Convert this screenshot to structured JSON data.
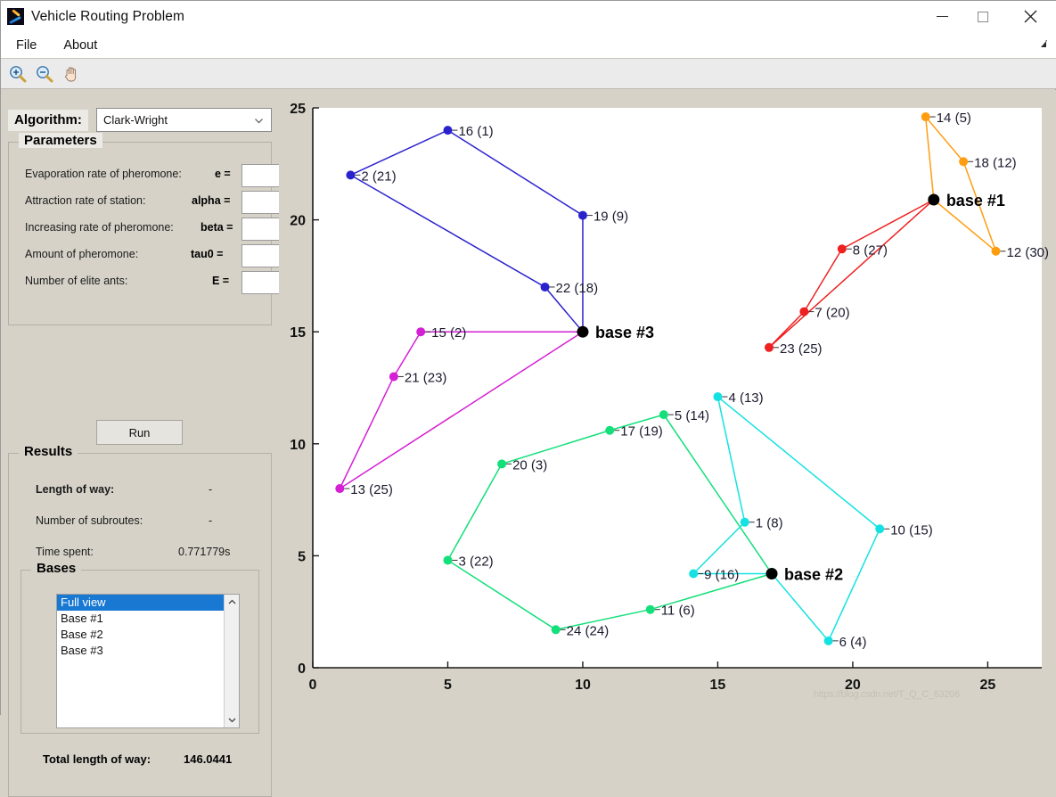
{
  "window": {
    "title": "Vehicle Routing Problem",
    "icon": "matlab-icon",
    "controls": {
      "minimize": "—",
      "maximize": "▢",
      "close": "✕"
    }
  },
  "menubar": {
    "items": [
      "File",
      "About"
    ],
    "right_icon": "undock-icon"
  },
  "toolbar": {
    "buttons": [
      "zoom-in-icon",
      "zoom-out-icon",
      "pan-hand-icon"
    ]
  },
  "algorithm": {
    "label": "Algorithm:",
    "selected": "Clark-Wright",
    "options": [
      "Clark-Wright"
    ]
  },
  "parameters": {
    "title": "Parameters",
    "rows": [
      {
        "label": "Evaporation rate of pheromone:",
        "symbol": "e =",
        "value": ""
      },
      {
        "label": "Attraction rate of station:",
        "symbol": "alpha =",
        "value": ""
      },
      {
        "label": "Increasing rate of pheromone:",
        "symbol": "beta =",
        "value": ""
      },
      {
        "label": "Amount of pheromone:",
        "symbol": "tau0 =",
        "value": ""
      },
      {
        "label": "Number of elite ants:",
        "symbol": "E =",
        "value": ""
      }
    ]
  },
  "run_button": {
    "label": "Run"
  },
  "results": {
    "title": "Results",
    "length_of_way_label": "Length of way:",
    "length_of_way_value": "-",
    "number_of_subroutes_label": "Number of subroutes:",
    "number_of_subroutes_value": "-",
    "time_spent_label": "Time spent:",
    "time_spent_value": "0.771779s",
    "bases": {
      "title": "Bases",
      "items": [
        "Full view",
        "Base #1",
        "Base #2",
        "Base #3"
      ],
      "selected_index": 0
    },
    "total_length_label": "Total length of way:",
    "total_length_value": "146.0441"
  },
  "watermark": "https://blog.csdn.net/T_Q_C_63206",
  "chart_data": {
    "type": "scatter",
    "title": "",
    "xlabel": "",
    "ylabel": "",
    "xlim": [
      0,
      27
    ],
    "ylim": [
      0,
      25
    ],
    "xticks": [
      0,
      5,
      10,
      15,
      20,
      25
    ],
    "yticks": [
      0,
      5,
      10,
      15,
      20,
      25
    ],
    "grid": false,
    "legend": "none",
    "bases": [
      {
        "name": "base #1",
        "x": 23.0,
        "y": 20.9,
        "color": "#000000"
      },
      {
        "name": "base #2",
        "x": 17.0,
        "y": 4.2,
        "color": "#000000"
      },
      {
        "name": "base #3",
        "x": 10.0,
        "y": 15.0,
        "color": "#000000"
      }
    ],
    "nodes": [
      {
        "id": 16,
        "demand": 1,
        "label": "16 (1)",
        "x": 5.0,
        "y": 24.0,
        "color": "#2a22cc"
      },
      {
        "id": 2,
        "demand": 21,
        "label": "2 (21)",
        "x": 1.4,
        "y": 22.0,
        "color": "#2a22cc"
      },
      {
        "id": 19,
        "demand": 9,
        "label": "19 (9)",
        "x": 10.0,
        "y": 20.2,
        "color": "#2a22cc"
      },
      {
        "id": 22,
        "demand": 18,
        "label": "22 (18)",
        "x": 8.6,
        "y": 17.0,
        "color": "#2a22cc"
      },
      {
        "id": 14,
        "demand": 5,
        "label": "14 (5)",
        "x": 22.7,
        "y": 24.6,
        "color": "#ff9d10"
      },
      {
        "id": 18,
        "demand": 12,
        "label": "18 (12)",
        "x": 24.1,
        "y": 22.6,
        "color": "#ff9d10"
      },
      {
        "id": 12,
        "demand": 30,
        "label": "12 (30)",
        "x": 25.3,
        "y": 18.6,
        "color": "#ff9d10"
      },
      {
        "id": 8,
        "demand": 27,
        "label": "8 (27)",
        "x": 19.6,
        "y": 18.7,
        "color": "#ee2020"
      },
      {
        "id": 7,
        "demand": 20,
        "label": "7 (20)",
        "x": 18.2,
        "y": 15.9,
        "color": "#ee2020"
      },
      {
        "id": 23,
        "demand": 25,
        "label": "23 (25)",
        "x": 16.9,
        "y": 14.3,
        "color": "#ee2020"
      },
      {
        "id": 15,
        "demand": 2,
        "label": "15 (2)",
        "x": 4.0,
        "y": 15.0,
        "color": "#d41fd4"
      },
      {
        "id": 21,
        "demand": 23,
        "label": "21 (23)",
        "x": 3.0,
        "y": 13.0,
        "color": "#d41fd4"
      },
      {
        "id": 13,
        "demand": 25,
        "label": "13 (25)",
        "x": 1.0,
        "y": 8.0,
        "color": "#d41fd4"
      },
      {
        "id": 5,
        "demand": 14,
        "label": "5 (14)",
        "x": 13.0,
        "y": 11.3,
        "color": "#13e07a"
      },
      {
        "id": 17,
        "demand": 19,
        "label": "17 (19)",
        "x": 11.0,
        "y": 10.6,
        "color": "#13e07a"
      },
      {
        "id": 20,
        "demand": 3,
        "label": "20 (3)",
        "x": 7.0,
        "y": 9.1,
        "color": "#13e07a"
      },
      {
        "id": 3,
        "demand": 22,
        "label": "3 (22)",
        "x": 5.0,
        "y": 4.8,
        "color": "#13e07a"
      },
      {
        "id": 24,
        "demand": 24,
        "label": "24 (24)",
        "x": 9.0,
        "y": 1.7,
        "color": "#13e07a"
      },
      {
        "id": 11,
        "demand": 6,
        "label": "11 (6)",
        "x": 12.5,
        "y": 2.6,
        "color": "#13e07a"
      },
      {
        "id": 4,
        "demand": 13,
        "label": "4 (13)",
        "x": 15.0,
        "y": 12.1,
        "color": "#14e2e2"
      },
      {
        "id": 1,
        "demand": 8,
        "label": "1 (8)",
        "x": 16.0,
        "y": 6.5,
        "color": "#14e2e2"
      },
      {
        "id": 9,
        "demand": 16,
        "label": "9 (16)",
        "x": 14.1,
        "y": 4.2,
        "color": "#14e2e2"
      },
      {
        "id": 10,
        "demand": 15,
        "label": "10 (15)",
        "x": 21.0,
        "y": 6.2,
        "color": "#14e2e2"
      },
      {
        "id": 6,
        "demand": 4,
        "label": "6 (4)",
        "x": 19.1,
        "y": 1.2,
        "color": "#14e2e2"
      }
    ],
    "routes": [
      {
        "name": "route-blue",
        "color": "#2a22cc",
        "base": "base #3",
        "sequence": [
          22,
          2,
          16,
          19
        ]
      },
      {
        "name": "route-magenta",
        "color": "#d41fd4",
        "base": "base #3",
        "sequence": [
          15,
          21,
          13
        ]
      },
      {
        "name": "route-orange",
        "color": "#ff9d10",
        "base": "base #1",
        "sequence": [
          14,
          18,
          12
        ]
      },
      {
        "name": "route-red",
        "color": "#ee2020",
        "base": "base #1",
        "sequence": [
          8,
          7,
          23
        ]
      },
      {
        "name": "route-green",
        "color": "#13e07a",
        "base": "base #2",
        "sequence": [
          5,
          17,
          20,
          3,
          24,
          11
        ]
      },
      {
        "name": "route-cyan",
        "color": "#14e2e2",
        "base": "base #2",
        "sequence": [
          9,
          1,
          4,
          10,
          6
        ]
      }
    ]
  }
}
